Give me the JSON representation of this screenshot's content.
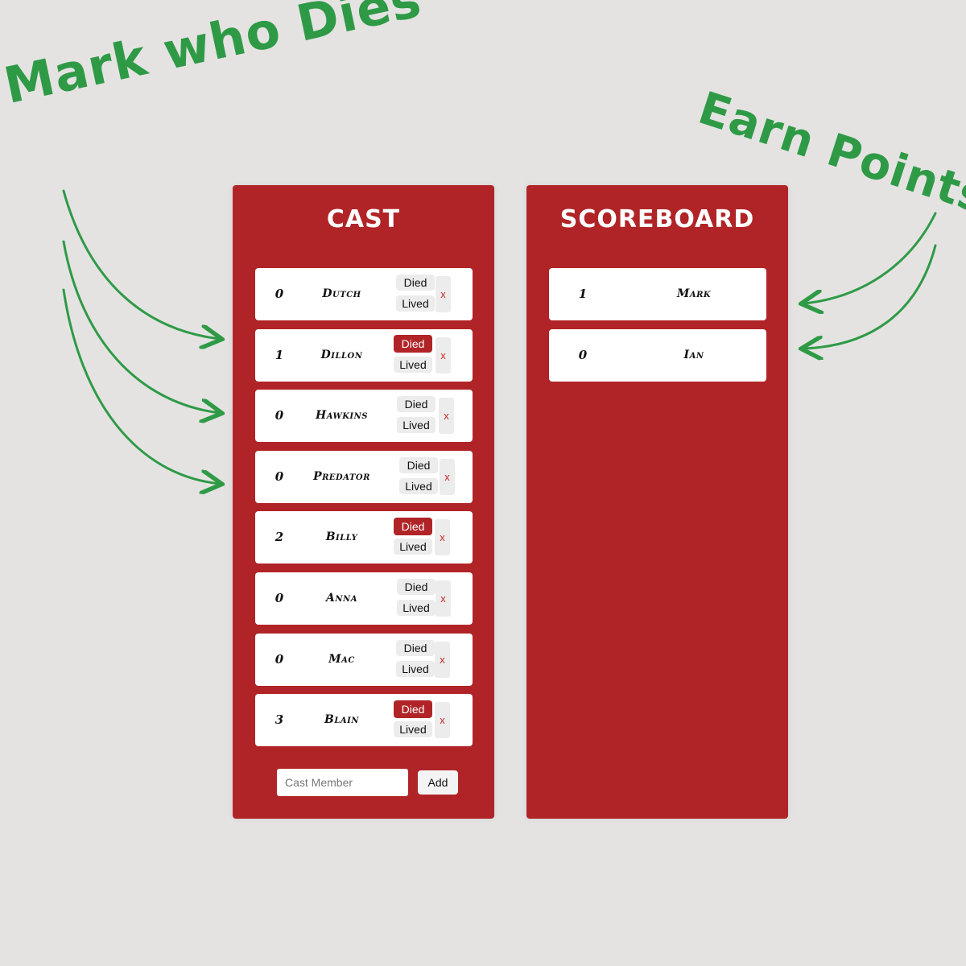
{
  "annotations": {
    "left": "Mark who Dies",
    "right": "Earn Points"
  },
  "colors": {
    "background": "#e4e3e2",
    "panel": "#b02427",
    "annotation": "#2f9a46"
  },
  "cast": {
    "title": "CAST",
    "status_died": "Died",
    "status_lived": "Lived",
    "remove_label": "x",
    "members": [
      {
        "score": "0",
        "name": "Dutch",
        "died": false
      },
      {
        "score": "1",
        "name": "Dillon",
        "died": true
      },
      {
        "score": "0",
        "name": "Hawkins",
        "died": false
      },
      {
        "score": "0",
        "name": "Predator",
        "died": false
      },
      {
        "score": "2",
        "name": "Billy",
        "died": true
      },
      {
        "score": "0",
        "name": "Anna",
        "died": false
      },
      {
        "score": "0",
        "name": "Mac",
        "died": false
      },
      {
        "score": "3",
        "name": "Blain",
        "died": true
      }
    ],
    "input_placeholder": "Cast Member",
    "add_label": "Add"
  },
  "scoreboard": {
    "title": "SCOREBOARD",
    "players": [
      {
        "score": "1",
        "name": "Mark"
      },
      {
        "score": "0",
        "name": "Ian"
      }
    ]
  }
}
